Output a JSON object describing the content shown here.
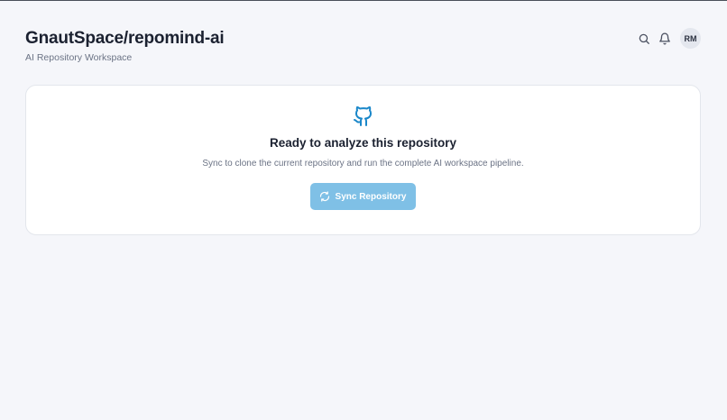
{
  "header": {
    "title": "GnautSpace/repomind-ai",
    "subtitle": "AI Repository Workspace",
    "avatar_initials": "RM",
    "actions": [
      {
        "icon": "search-icon"
      },
      {
        "icon": "bell-icon"
      }
    ]
  },
  "empty_state": {
    "icon": "github-icon",
    "title": "Ready to analyze this repository",
    "description": "Sync to clone the current repository and run the complete AI workspace pipeline.",
    "button": {
      "label": "Sync Repository",
      "icon": "refresh-icon"
    }
  },
  "colors": {
    "accent": "#1a87c9",
    "button_bg": "#7fc0e6",
    "page_bg": "#f5f6fa",
    "card_bg": "#ffffff"
  }
}
